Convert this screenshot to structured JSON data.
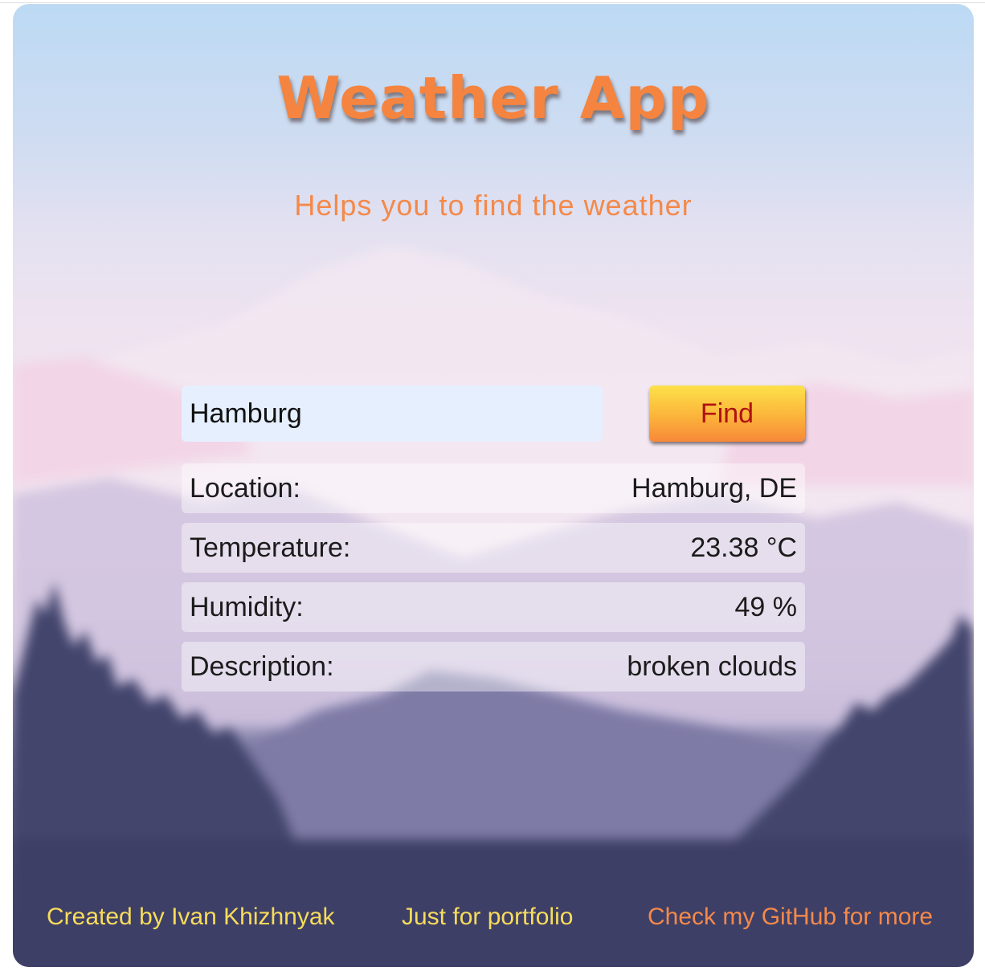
{
  "header": {
    "title": "Weather App",
    "subtitle": "Helps you to find the weather"
  },
  "search": {
    "value": "Hamburg",
    "button_label": "Find"
  },
  "weather": {
    "rows": [
      {
        "label": "Location:",
        "value": "Hamburg, DE"
      },
      {
        "label": "Temperature:",
        "value": "23.38 °C"
      },
      {
        "label": "Humidity:",
        "value": "49 %"
      },
      {
        "label": "Description:",
        "value": "broken clouds"
      }
    ]
  },
  "footer": {
    "credit": "Created by Ivan Khizhnyak",
    "note": "Just for portfolio",
    "github_link": "Check my GitHub for more"
  },
  "colors": {
    "title": "#f4843f",
    "subtitle": "#f4894a",
    "footer_text": "#f7dc5c",
    "footer_link": "#f4894a",
    "find_text": "#b01212",
    "input_background": "#e6effd",
    "forest_dark": "#3e3f66"
  }
}
